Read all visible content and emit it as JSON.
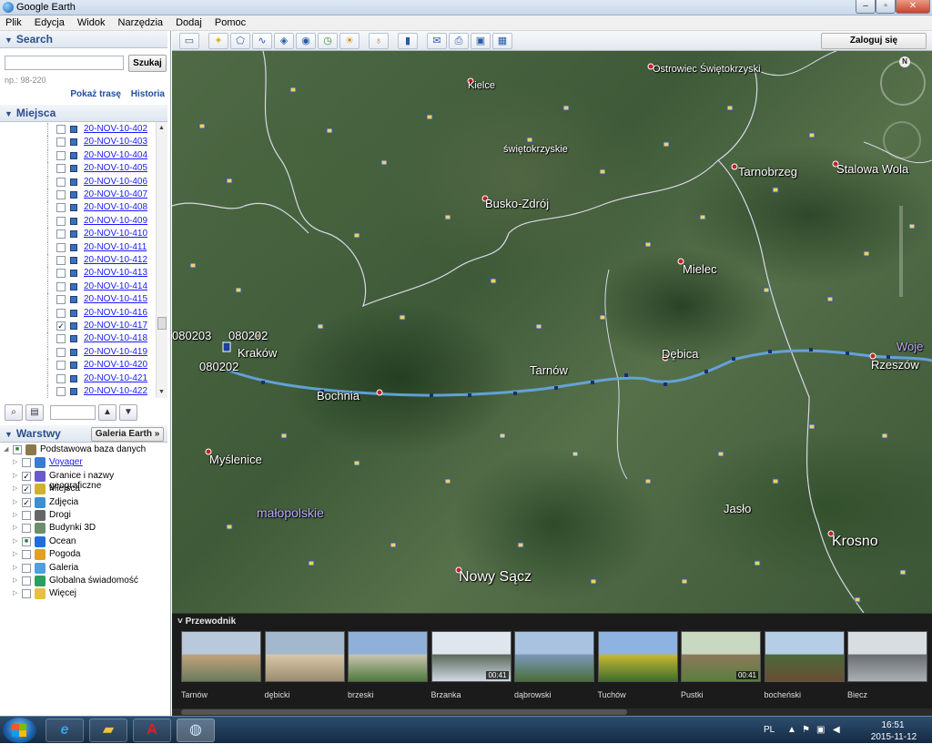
{
  "window": {
    "title": "Google Earth"
  },
  "window_buttons": {
    "minimize": "‒",
    "maximize": "▫",
    "close": "✕"
  },
  "menu": [
    "Plik",
    "Edycja",
    "Widok",
    "Narzędzia",
    "Dodaj",
    "Pomoc"
  ],
  "search": {
    "header": "Search",
    "input_value": "",
    "button_label": "Szukaj",
    "hint": "np.: 98-220",
    "link_route": "Pokaż trasę",
    "link_history": "Historia"
  },
  "places": {
    "header": "Miejsca",
    "items": [
      {
        "label": "20-NOV-10-402",
        "checked": false
      },
      {
        "label": "20-NOV-10-403",
        "checked": false
      },
      {
        "label": "20-NOV-10-404",
        "checked": false
      },
      {
        "label": "20-NOV-10-405",
        "checked": false
      },
      {
        "label": "20-NOV-10-406",
        "checked": false
      },
      {
        "label": "20-NOV-10-407",
        "checked": false
      },
      {
        "label": "20-NOV-10-408",
        "checked": false
      },
      {
        "label": "20-NOV-10-409",
        "checked": false
      },
      {
        "label": "20-NOV-10-410",
        "checked": false
      },
      {
        "label": "20-NOV-10-411",
        "checked": false
      },
      {
        "label": "20-NOV-10-412",
        "checked": false
      },
      {
        "label": "20-NOV-10-413",
        "checked": false
      },
      {
        "label": "20-NOV-10-414",
        "checked": false
      },
      {
        "label": "20-NOV-10-415",
        "checked": false
      },
      {
        "label": "20-NOV-10-416",
        "checked": false
      },
      {
        "label": "20-NOV-10-417",
        "checked": true
      },
      {
        "label": "20-NOV-10-418",
        "checked": false
      },
      {
        "label": "20-NOV-10-419",
        "checked": false
      },
      {
        "label": "20-NOV-10-420",
        "checked": false
      },
      {
        "label": "20-NOV-10-421",
        "checked": false
      },
      {
        "label": "20-NOV-10-422",
        "checked": false
      }
    ]
  },
  "layers": {
    "header": "Warstwy",
    "gallery_button": "Galeria Earth »",
    "items": [
      {
        "label": "Podstawowa baza danych",
        "checked": "partial",
        "icon": "database-icon",
        "color": "#8a7a4a",
        "level": 0
      },
      {
        "label": "Voyager",
        "checked": false,
        "icon": "voyager-icon",
        "color": "#3a7bd5",
        "level": 1,
        "link": true
      },
      {
        "label": "Granice i nazwy geograficzne",
        "checked": true,
        "icon": "borders-icon",
        "color": "#6a5acd",
        "level": 1
      },
      {
        "label": "Miejsca",
        "checked": true,
        "icon": "places-icon",
        "color": "#d0b030",
        "level": 1
      },
      {
        "label": "Zdjęcia",
        "checked": true,
        "icon": "photos-icon",
        "color": "#3d8fd0",
        "level": 1
      },
      {
        "label": "Drogi",
        "checked": false,
        "icon": "roads-icon",
        "color": "#666666",
        "level": 1
      },
      {
        "label": "Budynki 3D",
        "checked": false,
        "icon": "buildings-icon",
        "color": "#6b8e6b",
        "level": 1
      },
      {
        "label": "Ocean",
        "checked": "partial",
        "icon": "ocean-icon",
        "color": "#1e6fd9",
        "level": 1
      },
      {
        "label": "Pogoda",
        "checked": false,
        "icon": "weather-icon",
        "color": "#e0a020",
        "level": 1
      },
      {
        "label": "Galeria",
        "checked": false,
        "icon": "gallery-icon",
        "color": "#4fa0e0",
        "level": 1
      },
      {
        "label": "Globalna świadomość",
        "checked": false,
        "icon": "globe-icon",
        "color": "#2e9e5e",
        "level": 1
      },
      {
        "label": "Więcej",
        "checked": false,
        "icon": "more-icon",
        "color": "#e8c040",
        "level": 1
      }
    ]
  },
  "toolbar": {
    "login_label": "Zaloguj się",
    "buttons": [
      "sidebar-toggle-icon",
      "placemark-icon",
      "polygon-icon",
      "path-icon",
      "image-overlay-icon",
      "record-tour-icon",
      "historical-imagery-icon",
      "sunlight-icon",
      "planets-icon",
      "ruler-icon",
      "email-icon",
      "print-icon",
      "save-image-icon",
      "view-in-maps-icon"
    ]
  },
  "map": {
    "compass_label": "N",
    "labels": [
      {
        "text": "Kielce",
        "cls": "small"
      },
      {
        "text": "Ostrowiec Świętokrzyski",
        "cls": "small"
      },
      {
        "text": "świętokrzyskie",
        "cls": "small"
      },
      {
        "text": "Tarnobrzeg",
        "cls": ""
      },
      {
        "text": "Stalowa Wola",
        "cls": ""
      },
      {
        "text": "Busko-Zdrój",
        "cls": ""
      },
      {
        "text": "Mielec",
        "cls": ""
      },
      {
        "text": "080203",
        "cls": ""
      },
      {
        "text": "080202",
        "cls": ""
      },
      {
        "text": "Kraków",
        "cls": ""
      },
      {
        "text": "080202",
        "cls": ""
      },
      {
        "text": "Dębica",
        "cls": ""
      },
      {
        "text": "Woje",
        "cls": ""
      },
      {
        "text": "Rzeszów",
        "cls": ""
      },
      {
        "text": "Tarnów",
        "cls": ""
      },
      {
        "text": "Bochnia",
        "cls": ""
      },
      {
        "text": "Myślenice",
        "cls": ""
      },
      {
        "text": "małopolskie",
        "cls": "region"
      },
      {
        "text": "Jasło",
        "cls": ""
      },
      {
        "text": "Krosno",
        "cls": "big"
      },
      {
        "text": "Nowy Sącz",
        "cls": "big"
      }
    ]
  },
  "tour_guide": {
    "title": "Przewodnik",
    "items": [
      {
        "label": "Tarnów",
        "duration": "",
        "colors": [
          "#b9c9db",
          "#6b7b5a",
          "#c2a27c"
        ]
      },
      {
        "label": "dębicki",
        "duration": "",
        "colors": [
          "#a3b8cc",
          "#9b8c70",
          "#d8c8a8"
        ]
      },
      {
        "label": "brzeski",
        "duration": "",
        "colors": [
          "#8fb0d8",
          "#4f7a3e",
          "#c8c4b0"
        ]
      },
      {
        "label": "Brzanka",
        "duration": "00:41",
        "colors": [
          "#dfe6ee",
          "#cfd8e2",
          "#5a6a5a"
        ]
      },
      {
        "label": "dąbrowski",
        "duration": "",
        "colors": [
          "#a9c2e0",
          "#4a6e3a",
          "#7a98b8"
        ]
      },
      {
        "label": "Tuchów",
        "duration": "",
        "colors": [
          "#8eb3e0",
          "#3f6e2f",
          "#c8b830"
        ]
      },
      {
        "label": "Pustki",
        "duration": "00:41",
        "colors": [
          "#c9d8c0",
          "#5a7e3e",
          "#8c7a5a"
        ]
      },
      {
        "label": "bocheński",
        "duration": "",
        "colors": [
          "#b6cde6",
          "#6a4e34",
          "#4a6a3a"
        ]
      },
      {
        "label": "Biecz",
        "duration": "",
        "colors": [
          "#d8dde2",
          "#aab0b4",
          "#6a6e72"
        ]
      }
    ]
  },
  "taskbar": {
    "apps": [
      "internet-explorer-icon",
      "file-explorer-icon",
      "acrobat-icon",
      "google-earth-icon"
    ],
    "lang": "PL",
    "time": "16:51",
    "date": "2015-11-12"
  }
}
